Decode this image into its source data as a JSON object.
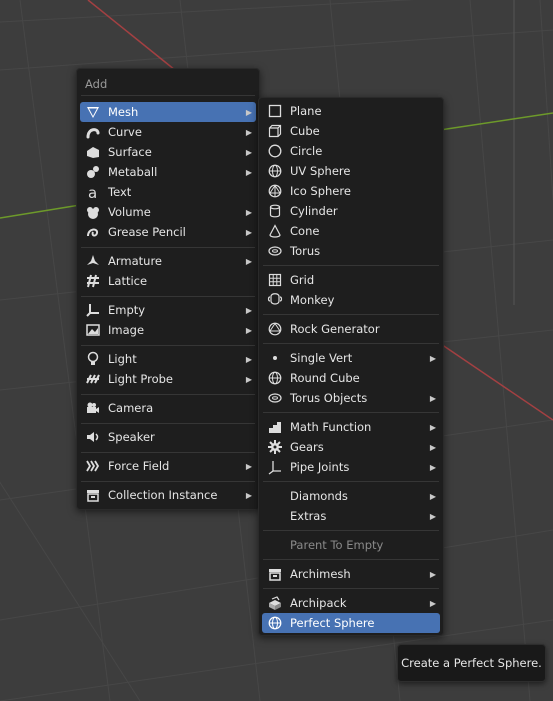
{
  "add_menu": {
    "title": "Add",
    "items": [
      {
        "label": "Mesh",
        "icon": "mesh-icon",
        "submenu": true,
        "active": true
      },
      {
        "label": "Curve",
        "icon": "curve-icon",
        "submenu": true
      },
      {
        "label": "Surface",
        "icon": "surface-icon",
        "submenu": true
      },
      {
        "label": "Metaball",
        "icon": "metaball-icon",
        "submenu": true
      },
      {
        "label": "Text",
        "icon": "text-icon",
        "submenu": false
      },
      {
        "label": "Volume",
        "icon": "volume-icon",
        "submenu": true
      },
      {
        "label": "Grease Pencil",
        "icon": "grease-pencil-icon",
        "submenu": true
      },
      {
        "label": "Armature",
        "icon": "armature-icon",
        "submenu": true
      },
      {
        "label": "Lattice",
        "icon": "lattice-icon",
        "submenu": false
      },
      {
        "label": "Empty",
        "icon": "empty-icon",
        "submenu": true
      },
      {
        "label": "Image",
        "icon": "image-icon",
        "submenu": true
      },
      {
        "label": "Light",
        "icon": "light-icon",
        "submenu": true
      },
      {
        "label": "Light Probe",
        "icon": "light-probe-icon",
        "submenu": true
      },
      {
        "label": "Camera",
        "icon": "camera-icon",
        "submenu": false
      },
      {
        "label": "Speaker",
        "icon": "speaker-icon",
        "submenu": false
      },
      {
        "label": "Force Field",
        "icon": "force-field-icon",
        "submenu": true
      },
      {
        "label": "Collection Instance",
        "icon": "collection-instance-icon",
        "submenu": true
      }
    ]
  },
  "mesh_menu": {
    "items": [
      {
        "label": "Plane",
        "icon": "plane-icon",
        "submenu": false
      },
      {
        "label": "Cube",
        "icon": "cube-icon",
        "submenu": false
      },
      {
        "label": "Circle",
        "icon": "circle-icon",
        "submenu": false
      },
      {
        "label": "UV Sphere",
        "icon": "uv-sphere-icon",
        "submenu": false
      },
      {
        "label": "Ico Sphere",
        "icon": "ico-sphere-icon",
        "submenu": false
      },
      {
        "label": "Cylinder",
        "icon": "cylinder-icon",
        "submenu": false
      },
      {
        "label": "Cone",
        "icon": "cone-icon",
        "submenu": false
      },
      {
        "label": "Torus",
        "icon": "torus-icon",
        "submenu": false
      },
      {
        "label": "Grid",
        "icon": "grid-icon",
        "submenu": false
      },
      {
        "label": "Monkey",
        "icon": "monkey-icon",
        "submenu": false
      },
      {
        "label": "Rock Generator",
        "icon": "rock-generator-icon",
        "submenu": false
      },
      {
        "label": "Single Vert",
        "icon": "single-vert-icon",
        "submenu": true
      },
      {
        "label": "Round Cube",
        "icon": "round-cube-icon",
        "submenu": false
      },
      {
        "label": "Torus Objects",
        "icon": "torus-objects-icon",
        "submenu": true
      },
      {
        "label": "Math Function",
        "icon": "math-function-icon",
        "submenu": true
      },
      {
        "label": "Gears",
        "icon": "gears-icon",
        "submenu": true
      },
      {
        "label": "Pipe Joints",
        "icon": "pipe-joints-icon",
        "submenu": true
      },
      {
        "label": "Diamonds",
        "icon": "",
        "submenu": true
      },
      {
        "label": "Extras",
        "icon": "",
        "submenu": true
      },
      {
        "label": "Parent To Empty",
        "icon": "",
        "submenu": false,
        "disabled": true
      },
      {
        "label": "Archimesh",
        "icon": "archimesh-icon",
        "submenu": true
      },
      {
        "label": "Archipack",
        "icon": "archipack-icon",
        "submenu": true
      },
      {
        "label": "Perfect Sphere",
        "icon": "perfect-sphere-icon",
        "submenu": false,
        "active": true
      }
    ]
  },
  "tooltip": {
    "text": "Create a Perfect Sphere."
  },
  "colors": {
    "highlight": "#4772b3",
    "menu_bg": "#1e1e1e",
    "viewport_bg": "#3d3d3d",
    "axis_red": "#a34042",
    "axis_green": "#6d9a2a"
  }
}
